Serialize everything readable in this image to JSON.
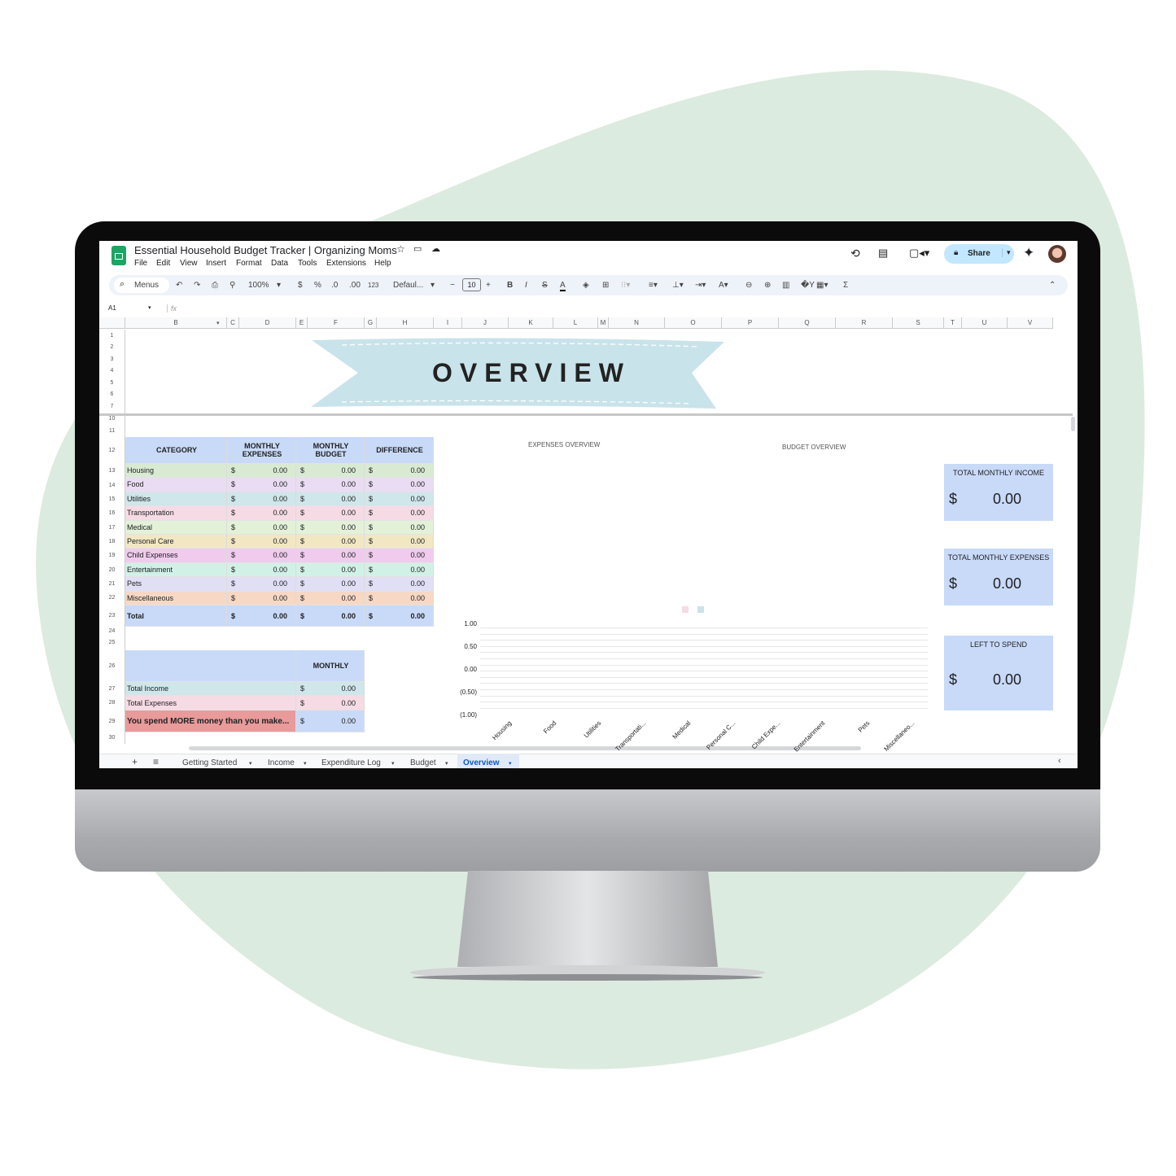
{
  "colors": {
    "background_blob": "#dcebdf",
    "header_blue": "#c9daf8",
    "banner": "#c9e3ea",
    "warning_red": "#e99a9a",
    "share_bg": "#c2e7ff",
    "active_tab": "#0b57d0"
  },
  "app": {
    "title": "Essential Household Budget Tracker | Organizing Moms",
    "menus": [
      "File",
      "Edit",
      "View",
      "Insert",
      "Format",
      "Data",
      "Tools",
      "Extensions",
      "Help"
    ],
    "share_label": "Share"
  },
  "toolbar": {
    "search_label": "Menus",
    "zoom": "100%",
    "currency": "$",
    "percent": "%",
    "dec_decrease": ".0",
    "dec_increase": ".00",
    "number_format": "123",
    "font": "Defaul...",
    "font_size": "10",
    "bold": "B",
    "italic": "I",
    "sum": "Σ"
  },
  "formula_bar": {
    "cell_ref": "A1",
    "fx": "fx"
  },
  "columns": [
    "B",
    "C",
    "D",
    "E",
    "F",
    "G",
    "H",
    "I",
    "J",
    "K",
    "L",
    "M",
    "N",
    "O",
    "P",
    "Q",
    "R",
    "S",
    "T",
    "U",
    "V"
  ],
  "rows": [
    "1",
    "2",
    "3",
    "4",
    "5",
    "6",
    "7",
    "10",
    "11",
    "12",
    "13",
    "14",
    "15",
    "16",
    "17",
    "18",
    "19",
    "20",
    "21",
    "22",
    "23",
    "24",
    "25",
    "26",
    "27",
    "28",
    "29",
    "30"
  ],
  "banner_title": "OVERVIEW",
  "category_table": {
    "headers": [
      "CATEGORY",
      "MONTHLY EXPENSES",
      "MONTHLY BUDGET",
      "DIFFERENCE"
    ],
    "currency": "$",
    "rows": [
      {
        "category": "Housing",
        "expenses": "0.00",
        "budget": "0.00",
        "difference": "0.00",
        "color": "#d9ead3"
      },
      {
        "category": "Food",
        "expenses": "0.00",
        "budget": "0.00",
        "difference": "0.00",
        "color": "#eadcf2"
      },
      {
        "category": "Utilities",
        "expenses": "0.00",
        "budget": "0.00",
        "difference": "0.00",
        "color": "#cfe6ea"
      },
      {
        "category": "Transportation",
        "expenses": "0.00",
        "budget": "0.00",
        "difference": "0.00",
        "color": "#f6dbe4"
      },
      {
        "category": "Medical",
        "expenses": "0.00",
        "budget": "0.00",
        "difference": "0.00",
        "color": "#e3f1d9"
      },
      {
        "category": "Personal Care",
        "expenses": "0.00",
        "budget": "0.00",
        "difference": "0.00",
        "color": "#f2e7c3"
      },
      {
        "category": "Child Expenses",
        "expenses": "0.00",
        "budget": "0.00",
        "difference": "0.00",
        "color": "#f0cbed"
      },
      {
        "category": "Entertainment",
        "expenses": "0.00",
        "budget": "0.00",
        "difference": "0.00",
        "color": "#d1f1e7"
      },
      {
        "category": "Pets",
        "expenses": "0.00",
        "budget": "0.00",
        "difference": "0.00",
        "color": "#e1dff6"
      },
      {
        "category": "Miscellaneous",
        "expenses": "0.00",
        "budget": "0.00",
        "difference": "0.00",
        "color": "#f6d8c5"
      }
    ],
    "total": {
      "category": "Total",
      "expenses": "0.00",
      "budget": "0.00",
      "difference": "0.00"
    }
  },
  "summary_table": {
    "header": "MONTHLY",
    "rows": [
      {
        "label": "Total Income",
        "value": "0.00",
        "color": "#cfe6ea"
      },
      {
        "label": "Total Expenses",
        "value": "0.00",
        "color": "#f6dbe4"
      },
      {
        "label": "You spend MORE money than you make...",
        "value": "0.00",
        "color": "#e99a9a"
      }
    ]
  },
  "cards": [
    {
      "label": "TOTAL MONTHLY INCOME",
      "currency": "$",
      "value": "0.00"
    },
    {
      "label": "TOTAL MONTHLY EXPENSES",
      "currency": "$",
      "value": "0.00"
    },
    {
      "label": "LEFT TO SPEND",
      "currency": "$",
      "value": "0.00"
    }
  ],
  "chart_data": {
    "type": "bar",
    "titles": [
      "EXPENSES OVERVIEW",
      "BUDGET OVERVIEW"
    ],
    "categories": [
      "Housing",
      "Food",
      "Utilities",
      "Transportati...",
      "Medical",
      "Personal C...",
      "Child Expe...",
      "Entertainment",
      "Pets",
      "Miscellaneo..."
    ],
    "series": [
      {
        "color": "#f6dbe4",
        "values": [
          0,
          0,
          0,
          0,
          0,
          0,
          0,
          0,
          0,
          0
        ]
      },
      {
        "color": "#c9e3ea",
        "values": [
          0,
          0,
          0,
          0,
          0,
          0,
          0,
          0,
          0,
          0
        ]
      }
    ],
    "yticks": [
      "1.00",
      "0.50",
      "0.00",
      "(0.50)",
      "(1.00)"
    ],
    "ylim": [
      -1,
      1
    ],
    "grid": true,
    "legend": "top"
  },
  "sheet_tabs": [
    {
      "label": "Getting Started"
    },
    {
      "label": "Income"
    },
    {
      "label": "Expenditure Log"
    },
    {
      "label": "Budget"
    },
    {
      "label": "Overview",
      "active": true
    }
  ]
}
